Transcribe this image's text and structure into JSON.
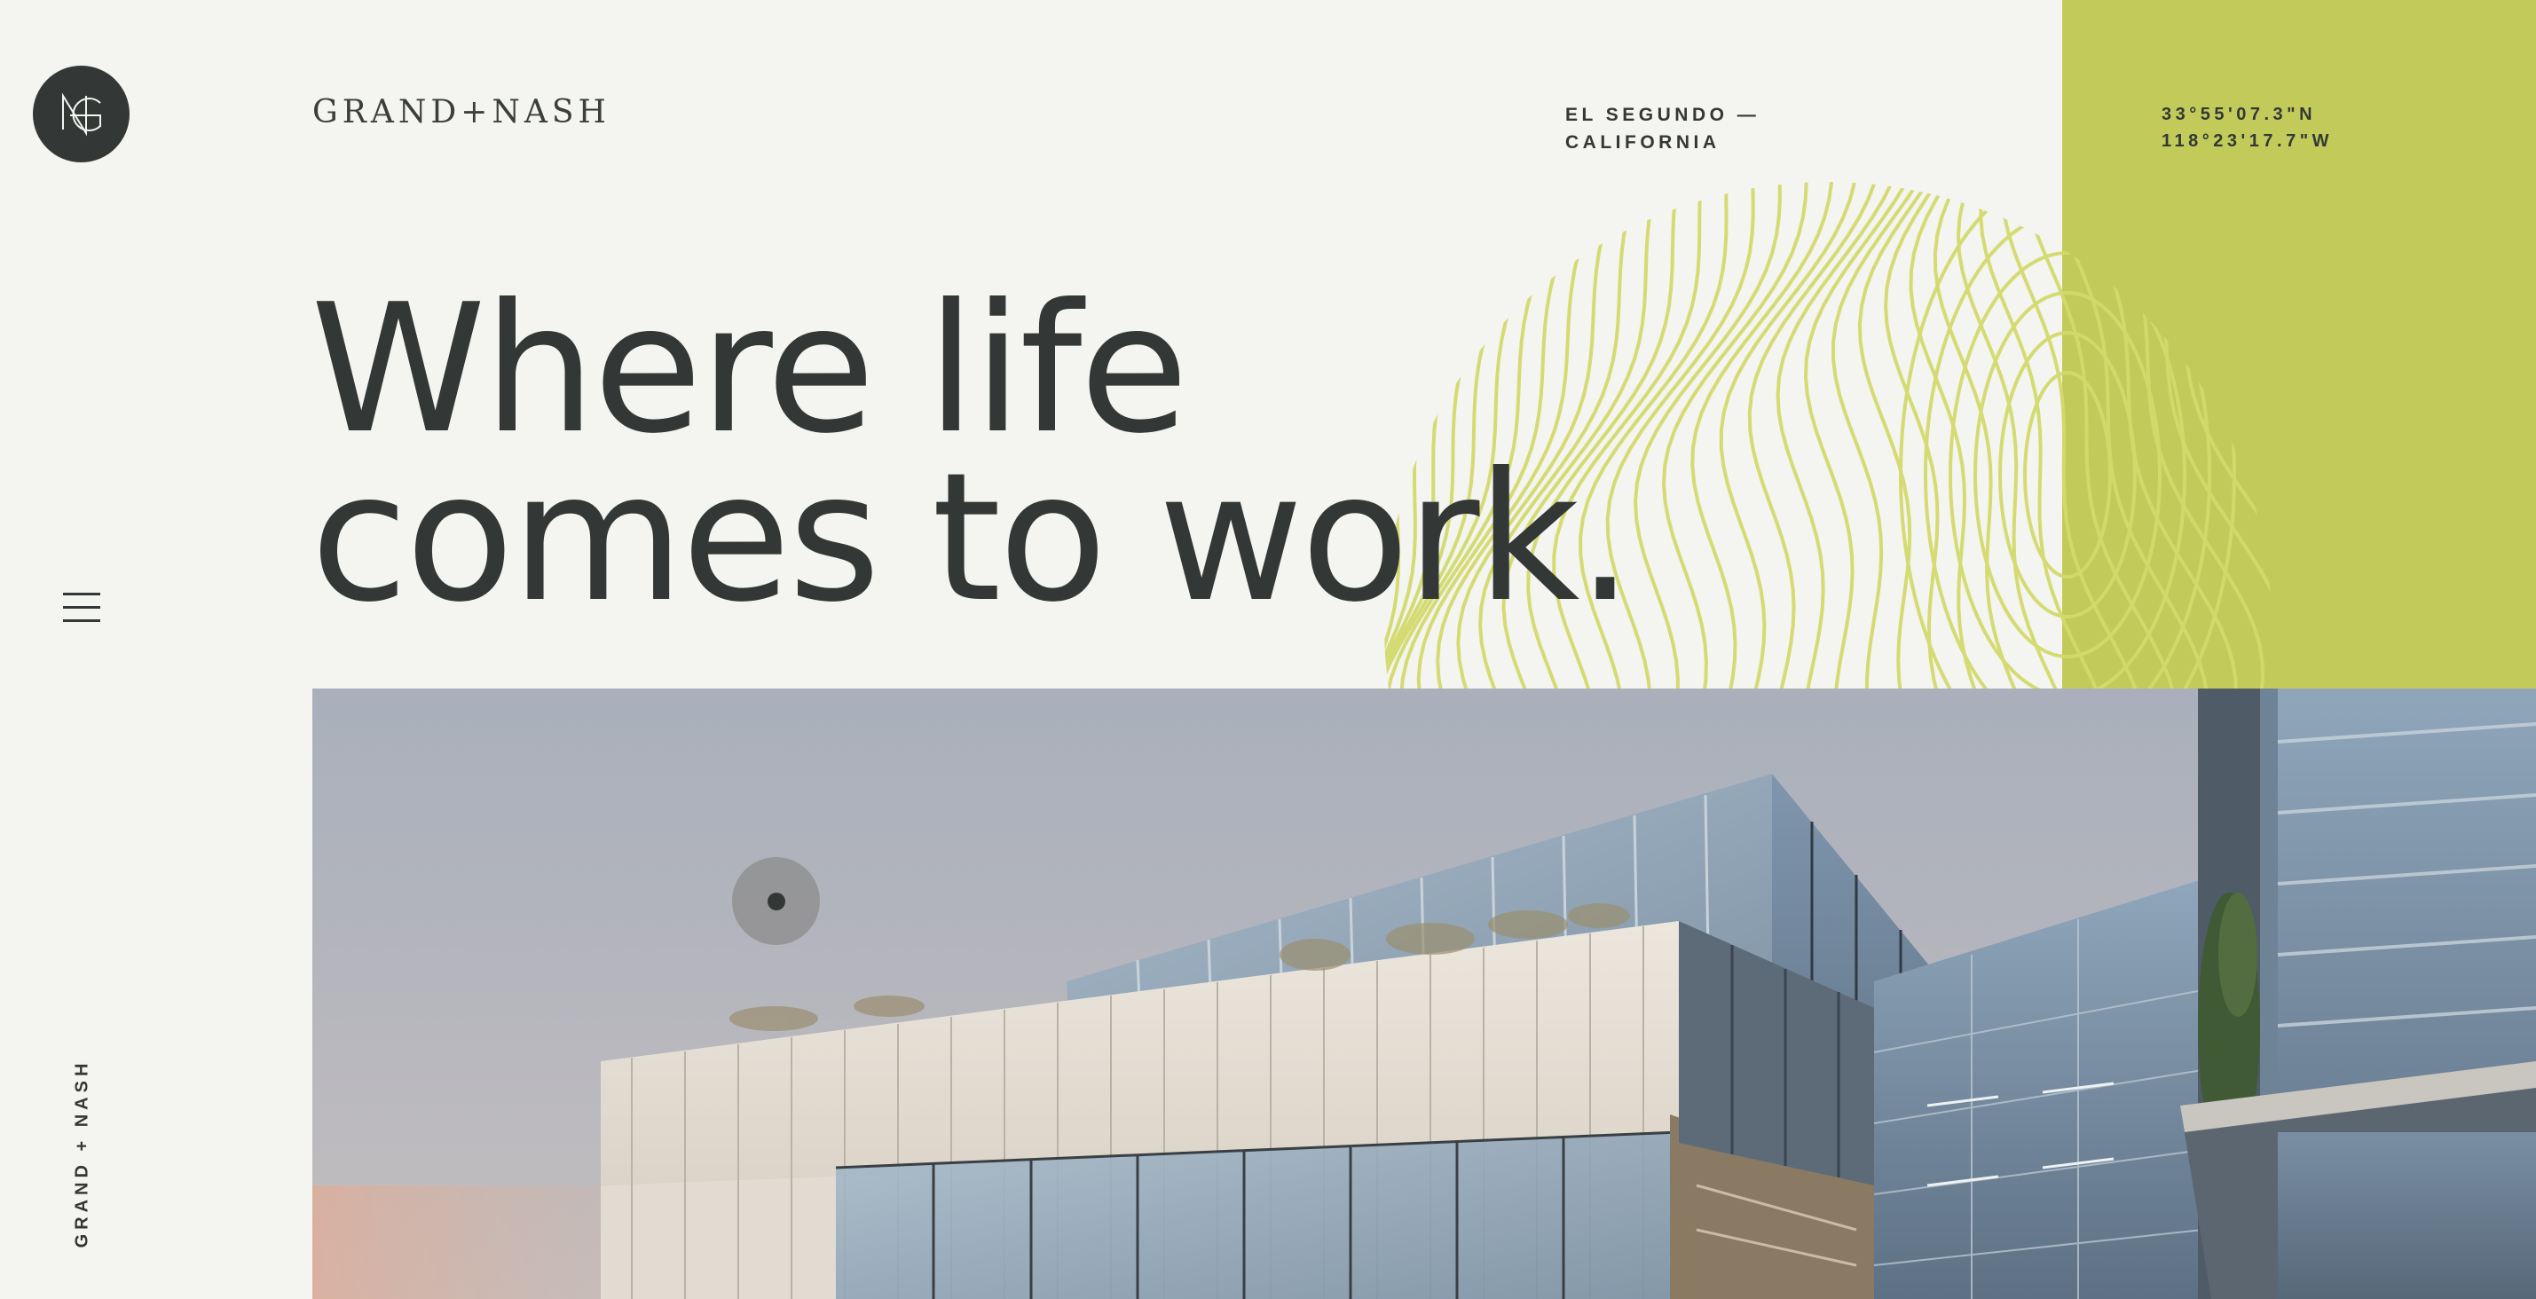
{
  "brand": {
    "wordmark": "GRAND+NASH",
    "vertical_label": "GRAND + NASH",
    "logo_icon": "gn-monogram-icon"
  },
  "location": {
    "line1": "EL SEGUNDO —",
    "line2": "CALIFORNIA"
  },
  "coordinates": {
    "lat": "33°55'07.3\"N",
    "lon": "118°23'17.7\"W"
  },
  "hero": {
    "line1": "Where life",
    "line2": "comes to work."
  },
  "nav": {
    "menu_icon": "hamburger-menu-icon"
  },
  "colors": {
    "background": "#f4f4f0",
    "accent_green": "#c2cb5a",
    "text_dark": "#333836",
    "topo_line": "#d3da6c"
  }
}
